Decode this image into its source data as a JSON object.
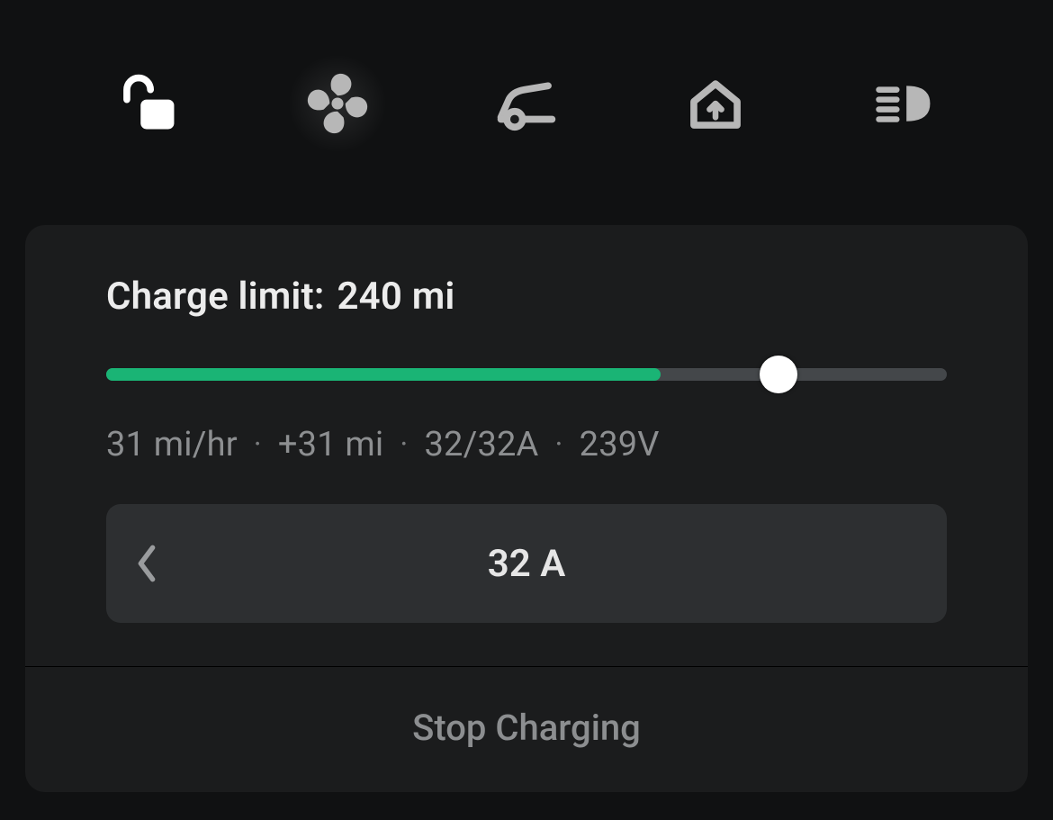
{
  "toolbar": {
    "items": [
      {
        "name": "lock-icon"
      },
      {
        "name": "fan-icon"
      },
      {
        "name": "frunk-icon"
      },
      {
        "name": "homelink-icon"
      },
      {
        "name": "headlights-icon"
      }
    ]
  },
  "charge": {
    "title_label": "Charge limit:",
    "limit_value": "240 mi",
    "slider": {
      "fill_percent": 66,
      "thumb_percent": 80
    },
    "stats": {
      "rate": "31 mi/hr",
      "added": "+31 mi",
      "amps": "32/32A",
      "volts": "239V"
    },
    "amp_selector_value": "32 A",
    "stop_label": "Stop Charging"
  }
}
